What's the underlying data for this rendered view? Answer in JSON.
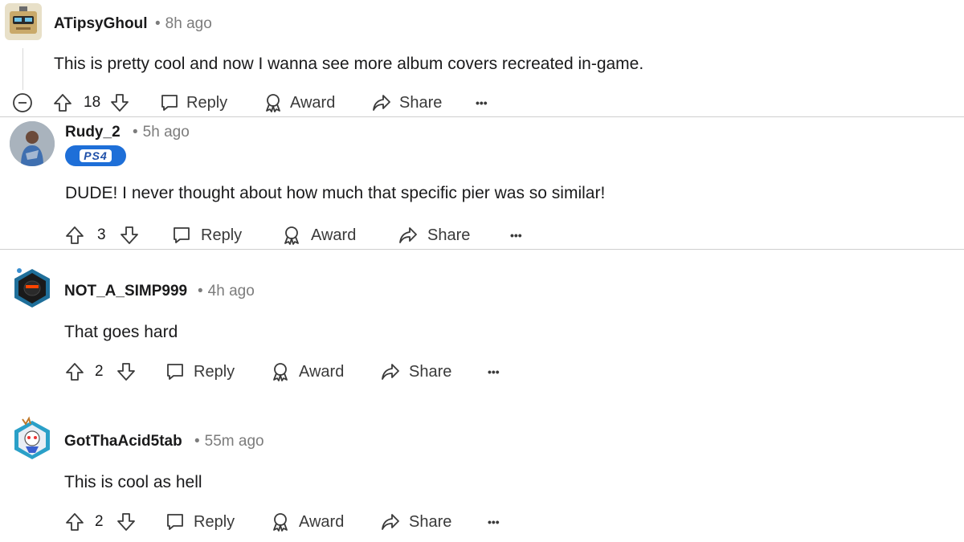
{
  "comments": [
    {
      "username": "ATipsyGhoul",
      "time": "8h ago",
      "body": "This is pretty cool and now I wanna see more album covers recreated in-game.",
      "votes": "18",
      "actions": {
        "reply": "Reply",
        "award": "Award",
        "share": "Share",
        "more": "•••"
      }
    },
    {
      "username": "Rudy_2",
      "time": "5h ago",
      "flair": "PS4",
      "body": "DUDE! I never thought about how much that specific pier was so similar!",
      "votes": "3",
      "actions": {
        "reply": "Reply",
        "award": "Award",
        "share": "Share",
        "more": "•••"
      }
    },
    {
      "username": "NOT_A_SIMP999",
      "time": "4h ago",
      "body": "That goes hard",
      "votes": "2",
      "actions": {
        "reply": "Reply",
        "award": "Award",
        "share": "Share",
        "more": "•••"
      }
    },
    {
      "username": "GotThaAcid5tab",
      "time": "55m ago",
      "body": "This is cool as hell",
      "votes": "2",
      "actions": {
        "reply": "Reply",
        "award": "Award",
        "share": "Share",
        "more": "•••"
      }
    }
  ],
  "colors": {
    "text": "#1a1a1b",
    "meta": "#7c7c7c",
    "divider": "#cfcfcf",
    "flair": "#1e6fd8"
  }
}
